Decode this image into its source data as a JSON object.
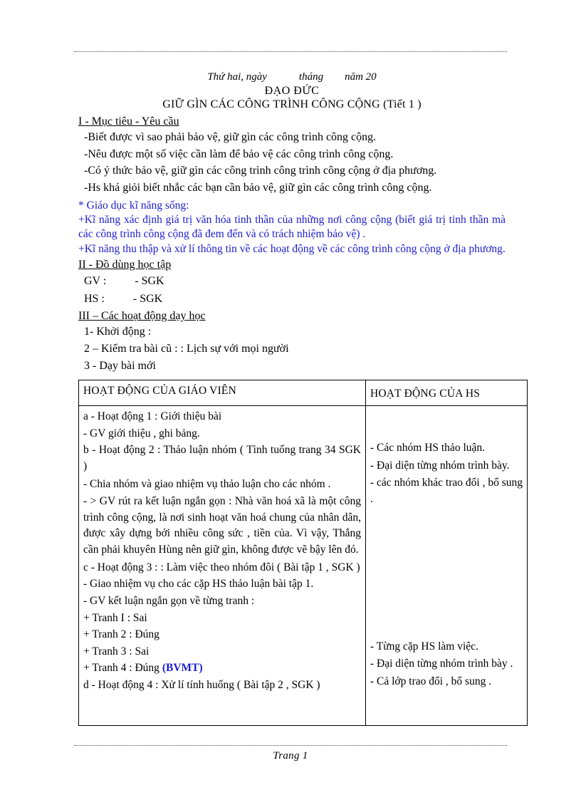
{
  "header": {
    "date_line": "Thứ hai, ngày            tháng        năm 20",
    "subject": "ĐẠO ĐỨC",
    "lesson_title": "GIỮ GÌN CÁC CÔNG TRÌNH CÔNG CỘNG (Tiết 1 )"
  },
  "footer": {
    "page_label": "Trang 1"
  },
  "colors": {
    "blue": "#1c1cd0",
    "text": "#000000"
  },
  "section_1": {
    "heading": "I - Mục tiêu - Yêu cầu",
    "items": [
      "-Biết được vì sao phải bảo vệ, giữ gìn các công trình công cộng.",
      "-Nêu được một số việc cần làm để bảo vệ các công trình công cộng.",
      "-Có ý thức bảo vệ, giữ gìn các công trình công trình công cộng ở địa phương.",
      "-Hs khá giỏi biết nhắc các bạn cần bảo vệ, giữ gìn các công trình công cộng."
    ],
    "life_skills_heading": "* Giáo dục kĩ năng sống:",
    "life_skills": [
      "+Kĩ năng xác định giá trị văn hóa tinh thần của những nơi công cộng (biết giá trị tinh thần mà các công trình  công cộng đã đem đến và có trách nhiệm  bảo vệ) .",
      "+Kĩ năng thu thập và xử lí thông tin về các hoạt động về các công trình  công cộng ở địa phương."
    ]
  },
  "section_2": {
    "heading": "II - Đồ dùng học tập",
    "teacher_line": "GV :          - SGK",
    "student_line": "HS :          - SGK"
  },
  "section_3": {
    "heading": "III – Các hoạt động dạy học",
    "items": [
      "1- Khởi động :",
      "2 – Kiểm tra bài cũ :  :  Lịch sự với mọi người",
      "3 - Dạy bài mới"
    ]
  },
  "table": {
    "headers": {
      "teacher": "HOẠT ĐỘNG CỦA GIÁO VIÊN",
      "student": "HOẠT ĐỘNG CỦA HS"
    },
    "teacher_column": [
      "a - Hoạt động 1 : Giới thiệu bài",
      "- GV giới thiệu , ghi bảng.",
      "b - Hoạt động 2 : Thảo luận nhóm ( Tình tuống trang 34 SGK )",
      "- Chia nhóm và giao nhiệm vụ thảo luận cho các nhóm .",
      "- > GV rút ra kết luận ngắn gọn : Nhà văn hoá xã là một công trình công cộng, là nơi sinh hoạt văn hoá chung của nhân dân, được xây dựng bởi nhiều công sức , tiền của. Vì vậy, Thắng cần phải khuyên Hùng nên giữ gìn, không được vẽ bậy lên đó.",
      "c - Hoạt động 3 : : Làm việc theo nhóm đôi ( Bài tập 1 , SGK )",
      "- Giao nhiệm vụ cho các cặp HS thảo luận bài tập 1.",
      "- GV kết luận ngắn gọn về từng tranh :",
      "+ Tranh I : Sai",
      "+ Tranh 2 : Đúng",
      "+ Tranh 3 : Sai",
      "d - Hoạt động 4 : Xử lí tính huống ( Bài tập 2 , SGK )"
    ],
    "teacher_tranh4": {
      "prefix": "+ Tranh 4 : Đúng ",
      "badge": "(BVMT)"
    },
    "student_column_top": [
      "- Các nhóm HS thảo luận.",
      " - Đại diện từng nhóm trình bày.",
      "- các nhóm khác trao đổi , bổ sung ."
    ],
    "student_column_bottom": [
      "- Từng cặp HS làm việc.",
      "- Đại diện từng nhóm trình bày .",
      "- Cả lớp trao đổi , bổ sung ."
    ]
  }
}
